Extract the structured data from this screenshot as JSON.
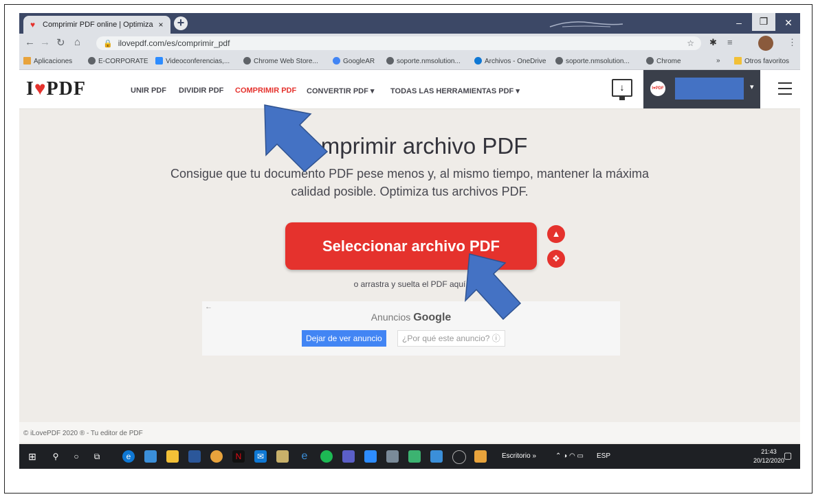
{
  "browser": {
    "tab_title": "Comprimir PDF online | Optimiza",
    "tab_close": "×",
    "new_tab": "+",
    "url": "ilovepdf.com/es/comprimir_pdf",
    "window_controls": [
      "–",
      "❐",
      "✕"
    ]
  },
  "bookmarks": {
    "items": [
      "Aplicaciones",
      "E-CORPORATE",
      "Videoconferencias,...",
      "Chrome Web Store...",
      "GoogleAR",
      "soporte.nmsolution...",
      "Archivos - OneDrive",
      "soporte.nmsolution...",
      "Chrome"
    ],
    "more": "»",
    "other": "Otros favoritos"
  },
  "site": {
    "logo_i": "I",
    "logo_heart": "♥",
    "logo_pdf": "PDF",
    "menu": [
      "UNIR PDF",
      "DIVIDIR PDF",
      "COMPRIMIR PDF",
      "CONVERTIR PDF ▾",
      "TODAS LAS HERRAMIENTAS PDF ▾"
    ],
    "active_menu": "COMPRIMIR PDF",
    "avatar_text": "I♥PDF",
    "user_caret": "▾"
  },
  "hero": {
    "title": "Comprimir archivo PDF",
    "subtitle": "Consigue que tu documento PDF pese menos y, al mismo tiempo, mantener la máxima calidad posible. Optimiza tus archivos PDF.",
    "select_button": "Seleccionar archivo PDF",
    "drop_hint": "o arrastra y suelta el PDF aquí"
  },
  "ad": {
    "back": "←",
    "label_prefix": "Anuncios",
    "label_brand": "Google",
    "stop_button": "Dejar de ver anuncio",
    "why_button": "¿Por qué este anuncio? ⓘ"
  },
  "footer": {
    "text": "© iLovePDF 2020 ® - Tu editor de PDF"
  },
  "taskbar": {
    "desktop_label": "Escritorio",
    "more": "»",
    "lang": "ESP",
    "time": "21:43",
    "date": "20/12/2020"
  },
  "colors": {
    "brand_red": "#e5322d",
    "annotation_arrow": "#4472c4"
  }
}
